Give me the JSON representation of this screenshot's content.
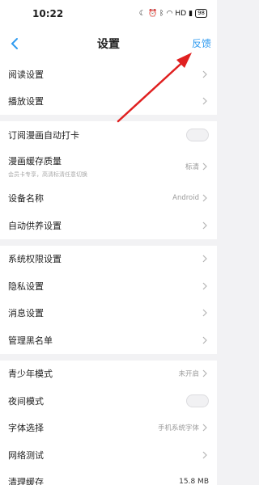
{
  "status_bar": {
    "time": "10:22",
    "icons": [
      "moon-icon",
      "alarm-icon",
      "bluetooth-icon",
      "wifi-icon",
      "hd-icon",
      "signal-icon"
    ],
    "hd_label": "HD",
    "battery": "98"
  },
  "nav": {
    "title": "设置",
    "feedback": "反馈",
    "accent": "#2f9bf0"
  },
  "groups": {
    "g1": {
      "reading": "阅读设置",
      "playback": "播放设置"
    },
    "g2": {
      "checkin": "订阅漫画自动打卡",
      "cache_quality": "漫画缓存质量",
      "cache_quality_sub": "会员卡专享，高清标清任意切换",
      "cache_quality_value": "标清",
      "device_name": "设备名称",
      "device_name_value": "Android",
      "auto_feed": "自动供养设置"
    },
    "g3": {
      "permissions": "系统权限设置",
      "privacy": "隐私设置",
      "messages": "消息设置",
      "blacklist": "管理黑名单"
    },
    "g4": {
      "teen": "青少年模式",
      "teen_value": "未开启",
      "night": "夜间模式",
      "font": "字体选择",
      "font_value": "手机系统字体",
      "network": "网络测试",
      "cache": "清理缓存",
      "cache_value": "15.8 MB"
    }
  },
  "annotation_color": "#e02020"
}
